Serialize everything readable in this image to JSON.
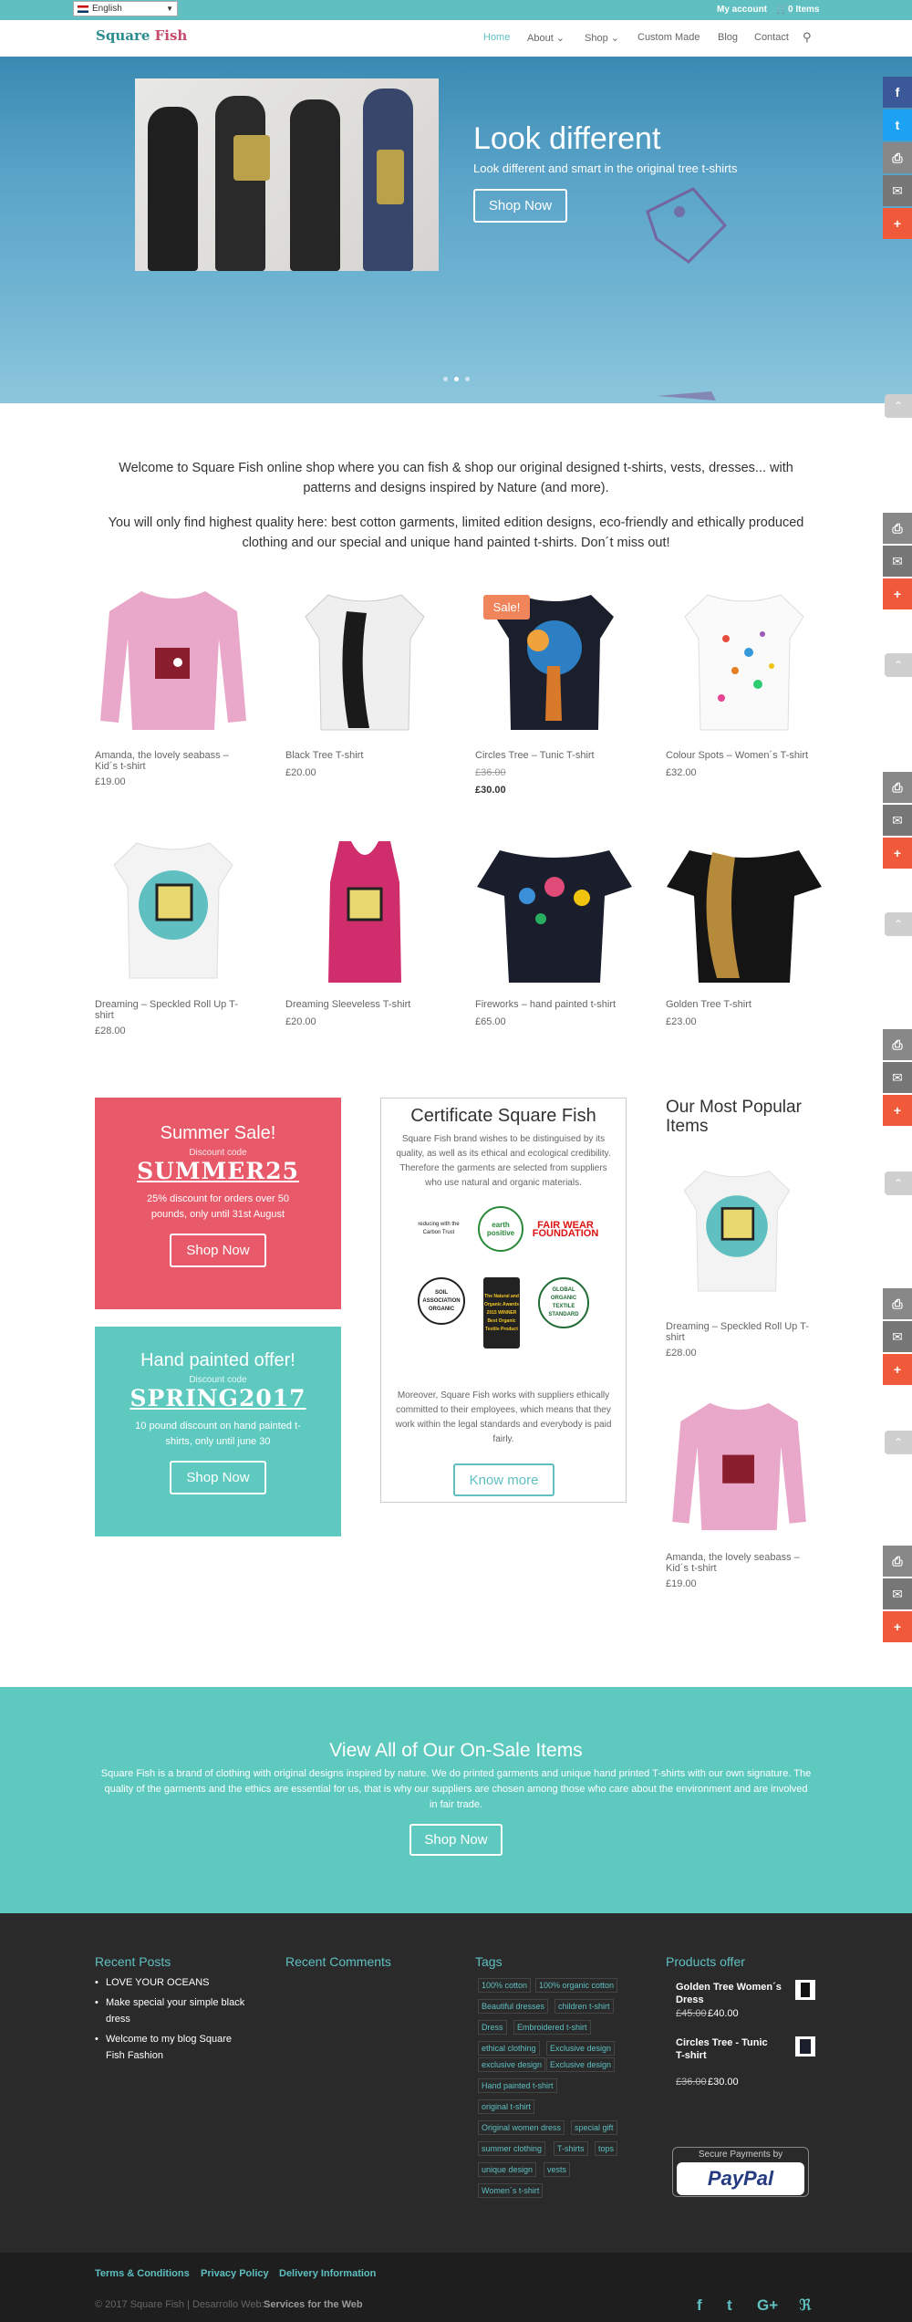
{
  "topbar": {
    "language": "English",
    "my_account": "My account",
    "cart": "0 Items"
  },
  "logo": {
    "part1": "Square",
    "part2": "Fish"
  },
  "nav": [
    {
      "label": "Home"
    },
    {
      "label": "About ⌄"
    },
    {
      "label": "Shop ⌄"
    },
    {
      "label": "Custom Made"
    },
    {
      "label": "Blog"
    },
    {
      "label": "Contact"
    }
  ],
  "hero": {
    "title": "Look different",
    "subtitle": "Look different and smart in the original tree t-shirts",
    "button": "Shop Now"
  },
  "social": {
    "facebook": "f",
    "twitter": "t",
    "print": "⎙",
    "email": "✉",
    "more": "+",
    "up": "⌃"
  },
  "welcome": {
    "p1": "Welcome to Square Fish online shop where you can fish & shop our original designed t-shirts, vests, dresses... with patterns and designs inspired by Nature (and more).",
    "p2": "You will only find highest quality here: best cotton garments, limited edition designs, eco-friendly and ethically produced clothing and our special and unique hand painted t-shirts. Don´t miss out!"
  },
  "products": [
    {
      "name": "Amanda, the lovely seabass – Kid´s t-shirt",
      "price": "£19.00",
      "old": ""
    },
    {
      "name": "Black Tree T-shirt",
      "price": "£20.00",
      "old": ""
    },
    {
      "name": "Circles Tree – Tunic T-shirt",
      "price": "£30.00",
      "old": "£36.00",
      "badge": "Sale!"
    },
    {
      "name": "Colour Spots – Women´s T-shirt",
      "price": "£32.00",
      "old": ""
    },
    {
      "name": "Dreaming – Speckled Roll Up T-shirt",
      "price": "£28.00",
      "old": ""
    },
    {
      "name": "Dreaming Sleeveless T-shirt",
      "price": "£20.00",
      "old": ""
    },
    {
      "name": "Fireworks – hand painted t-shirt",
      "price": "£65.00",
      "old": ""
    },
    {
      "name": "Golden Tree T-shirt",
      "price": "£23.00",
      "old": ""
    }
  ],
  "promos": [
    {
      "title": "Summer Sale!",
      "code_label": "Discount code",
      "code": "SUMMER25",
      "desc": "25% discount for orders over 50 pounds, only until 31st August",
      "button": "Shop Now",
      "color": "#e85a6a"
    },
    {
      "title": "Hand painted offer!",
      "code_label": "Discount code",
      "code": "SPRING2017",
      "desc": "10 pound discount on hand painted t-shirts, only until june 30",
      "button": "Shop Now",
      "color": "#5ecabf"
    }
  ],
  "certificate": {
    "title": "Certificate Square Fish",
    "p1": "Square Fish brand wishes to be distinguised by its quality, as well as its ethical and ecological credibility. Therefore the garments are selected from suppliers who use natural and organic materials.",
    "p2": "Moreover, Square Fish works with suppliers ethically committed to their employees, which means that they work within the legal standards and everybody is paid fairly.",
    "button": "Know more",
    "logos": {
      "carbon": "reducing with the Carbon Trust",
      "earth": "earth positive",
      "fairwear": "FAIR WEAR FOUNDATION",
      "soil": "SOIL ASSOCIATION ORGANIC",
      "award": "The Natural and Organic Awards 2015 WINNER Best Organic Textile Product",
      "gots": "GLOBAL ORGANIC TEXTILE STANDARD"
    }
  },
  "popular": {
    "title": "Our Most Popular Items",
    "items": [
      {
        "name": "Dreaming – Speckled Roll Up T-shirt",
        "price": "£28.00"
      },
      {
        "name": "Amanda, the lovely seabass – Kid´s t-shirt",
        "price": "£19.00"
      }
    ]
  },
  "onsale": {
    "title": "View All of Our On-Sale Items",
    "text": "Square Fish is a brand of clothing with original designs inspired by nature. We do printed garments and unique hand printed T-shirts with our own signature. The quality of the garments and the ethics are essential for us, that is why our suppliers are chosen among those who care about the environment and are involved in fair trade.",
    "button": "Shop Now"
  },
  "footer": {
    "recent_posts_title": "Recent Posts",
    "posts": [
      "LOVE YOUR OCEANS",
      "Make special your simple black dress",
      "Welcome to my blog Square Fish Fashion"
    ],
    "recent_comments_title": "Recent Comments",
    "tags_title": "Tags",
    "tags": [
      "100% cotton",
      "100% organic cotton",
      "Beautiful dresses",
      "children t-shirt",
      "Dress",
      "Embroidered t-shirt",
      "ethical clothing",
      "Exclusive design",
      "exclusive design",
      "Hand painted t-shirt",
      "original t-shirt",
      "Original women dress",
      "special gift",
      "summer clothing",
      "T-shirts",
      "tops",
      "unique design",
      "vests",
      "Women´s t-shirt"
    ],
    "products_title": "Products offer",
    "offers": [
      {
        "name": "Golden Tree Women´s Dress",
        "old": "£45.00",
        "price": "£40.00"
      },
      {
        "name": "Circles Tree - Tunic T-shirt",
        "old": "£36.00",
        "price": "£30.00"
      }
    ],
    "paypal_label": "Secure Payments by",
    "paypal": "PayPal",
    "links": [
      "Terms & Conditions",
      "Privacy Policy",
      "Delivery Information"
    ],
    "copyright": "© 2017 Square Fish | Desarrollo Web:",
    "credit": "Services for the Web",
    "social_icons": {
      "facebook": "f",
      "twitter": "t",
      "gplus": "G+",
      "rss": "ℜ"
    }
  },
  "colors": {
    "teal": "#5fbfc1",
    "mint": "#5ecabf",
    "coral": "#e85a6a",
    "orange": "#f0845a",
    "dark": "#2a2a2a"
  }
}
